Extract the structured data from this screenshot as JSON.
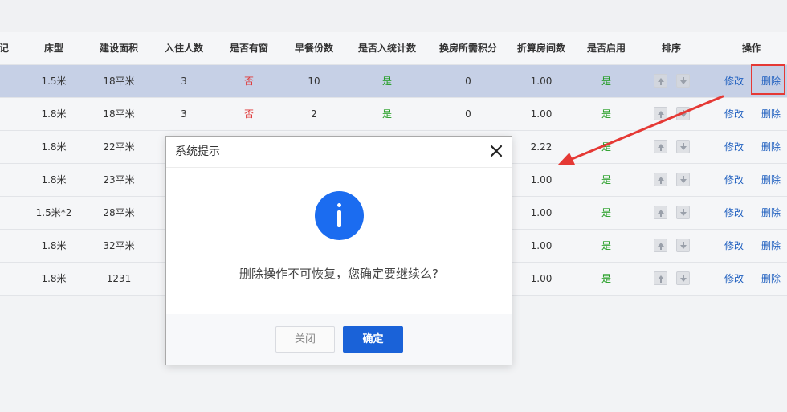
{
  "table": {
    "columns": [
      "记",
      "床型",
      "建设面积",
      "入住人数",
      "是否有窗",
      "早餐份数",
      "是否入统计数",
      "换房所需积分",
      "折算房间数",
      "是否启用",
      "排序",
      "操作"
    ],
    "rows": [
      {
        "bed": "1.5米",
        "area": "18平米",
        "guests": "3",
        "window": "否",
        "breakfast": "10",
        "counted": "是",
        "points": "0",
        "rooms": "1.00",
        "enabled": "是"
      },
      {
        "bed": "1.8米",
        "area": "18平米",
        "guests": "3",
        "window": "否",
        "breakfast": "2",
        "counted": "是",
        "points": "0",
        "rooms": "1.00",
        "enabled": "是"
      },
      {
        "bed": "1.8米",
        "area": "22平米",
        "guests": "",
        "window": "",
        "breakfast": "",
        "counted": "",
        "points": "",
        "rooms": "2.22",
        "enabled": "是"
      },
      {
        "bed": "1.8米",
        "area": "23平米",
        "guests": "",
        "window": "",
        "breakfast": "",
        "counted": "",
        "points": "",
        "rooms": "1.00",
        "enabled": "是"
      },
      {
        "bed": "1.5米*2",
        "area": "28平米",
        "guests": "",
        "window": "",
        "breakfast": "",
        "counted": "",
        "points": "",
        "rooms": "1.00",
        "enabled": "是"
      },
      {
        "bed": "1.8米",
        "area": "32平米",
        "guests": "",
        "window": "",
        "breakfast": "",
        "counted": "",
        "points": "",
        "rooms": "1.00",
        "enabled": "是"
      },
      {
        "bed": "1.8米",
        "area": "1231",
        "guests": "",
        "window": "",
        "breakfast": "",
        "counted": "",
        "points": "",
        "rooms": "1.00",
        "enabled": "是"
      }
    ],
    "actions": {
      "edit": "修改",
      "delete": "删除"
    },
    "sort_icons": [
      "arrow-up-icon",
      "arrow-down-icon"
    ]
  },
  "dialog": {
    "title": "系统提示",
    "message": "删除操作不可恢复，您确定要继续么?",
    "close_button": "关闭",
    "ok_button": "确定",
    "icon": "info-icon"
  },
  "colors": {
    "primary": "#1a62d8",
    "no": "#e03a3a",
    "yes": "#1c9a1c",
    "selected_row": "#c6d0e6",
    "highlight": "#e53935",
    "link": "#1f5fbf"
  }
}
